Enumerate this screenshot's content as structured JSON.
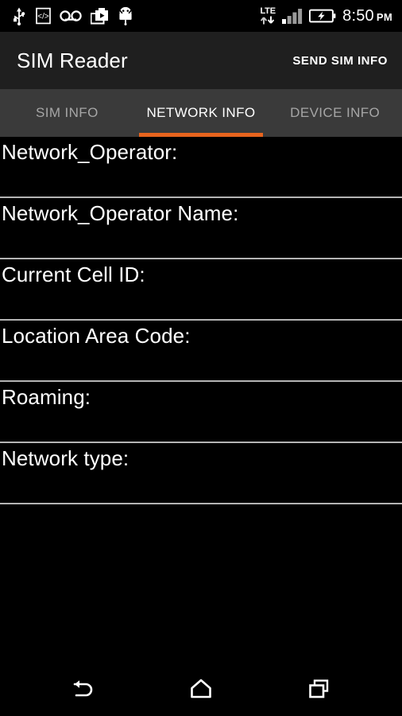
{
  "status_bar": {
    "left_icons": [
      {
        "name": "usb-icon",
        "label": "USB"
      },
      {
        "name": "developer-code-icon",
        "label": "Developer options"
      },
      {
        "name": "voicemail-icon",
        "label": "Voicemail"
      },
      {
        "name": "media-briefcase-icon",
        "label": "Media"
      },
      {
        "name": "android-robot-icon",
        "label": "Android"
      }
    ],
    "network_type": "LTE",
    "data_arrows": "up-down",
    "signal_bars_filled": 3,
    "signal_bars_total": 4,
    "battery_state": "charging",
    "time": "8:50",
    "am_pm": "PM"
  },
  "app_bar": {
    "title": "SIM Reader",
    "action_label": "SEND SIM INFO"
  },
  "tabs": {
    "active_index": 1,
    "accent_color": "#e8641e",
    "items": [
      {
        "label": "SIM INFO",
        "name": "tab-sim-info"
      },
      {
        "label": "NETWORK INFO",
        "name": "tab-network-info"
      },
      {
        "label": "DEVICE INFO",
        "name": "tab-device-info"
      }
    ]
  },
  "network_info": {
    "rows": [
      {
        "label": "Network_Operator:",
        "value": ""
      },
      {
        "label": "Network_Operator Name:",
        "value": ""
      },
      {
        "label": "Current Cell ID:",
        "value": ""
      },
      {
        "label": "Location Area Code:",
        "value": ""
      },
      {
        "label": "Roaming:",
        "value": ""
      },
      {
        "label": "Network type:",
        "value": ""
      }
    ]
  },
  "nav_bar": {
    "buttons": [
      {
        "name": "nav-back-button",
        "label": "Back"
      },
      {
        "name": "nav-home-button",
        "label": "Home"
      },
      {
        "name": "nav-recents-button",
        "label": "Recent apps"
      }
    ]
  },
  "colors": {
    "background": "#000000",
    "app_bar": "#1f1f1f",
    "tab_bar": "#3a3a3a",
    "accent": "#e8641e",
    "divider": "#b4b4b4",
    "inactive_tab_text": "#a6a6a6"
  }
}
